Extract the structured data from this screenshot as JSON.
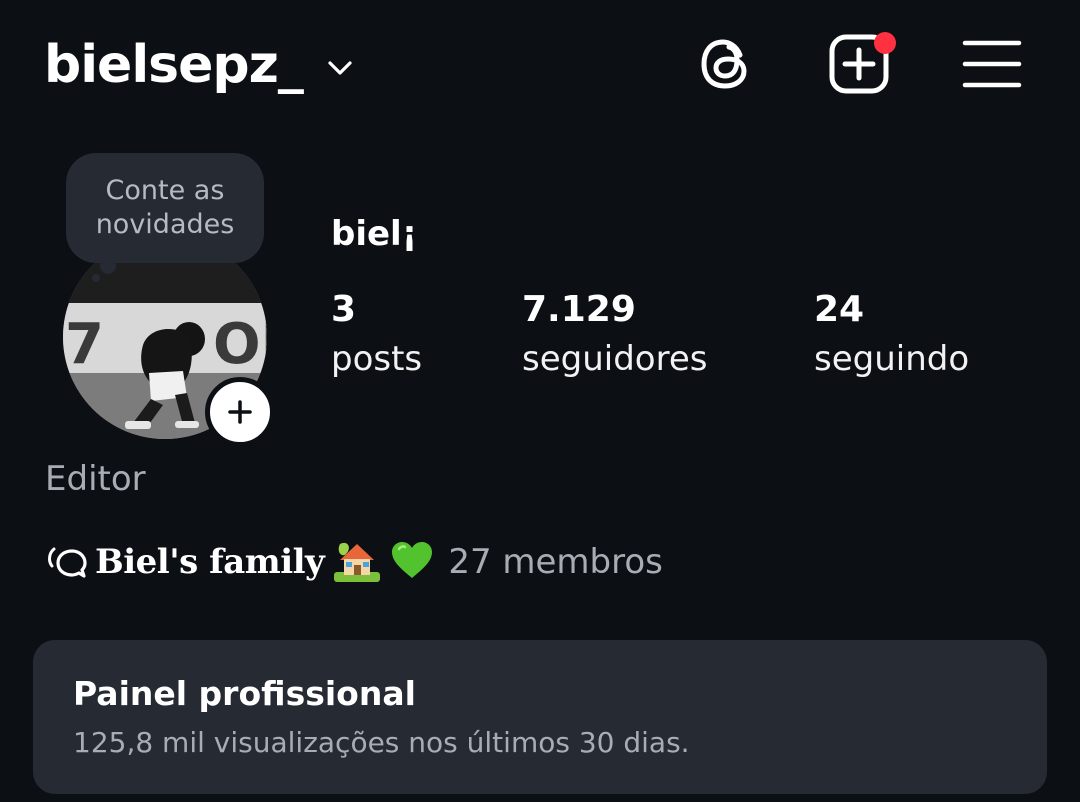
{
  "header": {
    "username": "bielsepz_",
    "icons": {
      "switch_account": "chevron-down-icon",
      "threads": "threads-icon",
      "create": "create-post-icon",
      "menu": "hamburger-menu-icon"
    },
    "notification_color": "#ff3040"
  },
  "note": {
    "line1": "Conte as",
    "line2": "novidades"
  },
  "profile": {
    "display_name": "biel¡",
    "stats": {
      "posts": {
        "value": "3",
        "label": "posts"
      },
      "followers": {
        "value": "7.129",
        "label": "seguidores"
      },
      "following": {
        "value": "24",
        "label": "seguindo"
      }
    },
    "category": "Editor"
  },
  "channel": {
    "icon": "broadcast-channel-icon",
    "name": "Biel's family",
    "emoji_house": "🏡",
    "emoji_heart": "💚",
    "members": "27 membros"
  },
  "professional_dashboard": {
    "title": "Painel profissional",
    "subtitle": "125,8 mil visualizações nos últimos 30 dias."
  },
  "colors": {
    "background": "#0c0f14",
    "card": "#262a33",
    "secondary_text": "#a8acb4"
  }
}
